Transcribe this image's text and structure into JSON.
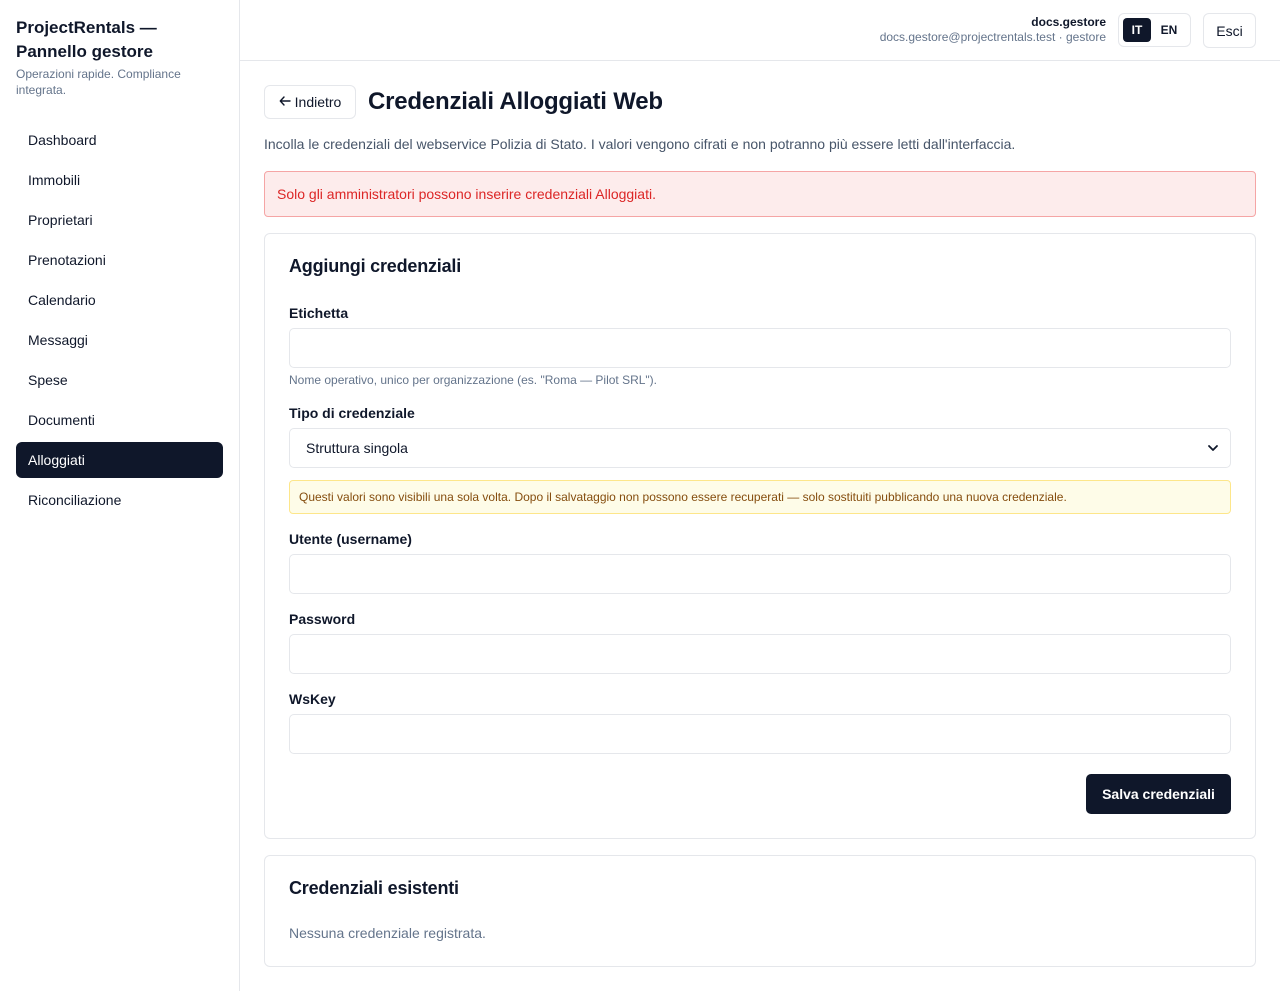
{
  "sidebar": {
    "brand_title": "ProjectRentals — Pannello gestore",
    "brand_subtitle": "Operazioni rapide. Compliance integrata.",
    "items": [
      {
        "label": "Dashboard"
      },
      {
        "label": "Immobili"
      },
      {
        "label": "Proprietari"
      },
      {
        "label": "Prenotazioni"
      },
      {
        "label": "Calendario"
      },
      {
        "label": "Messaggi"
      },
      {
        "label": "Spese"
      },
      {
        "label": "Documenti"
      },
      {
        "label": "Alloggiati",
        "active": true
      },
      {
        "label": "Riconciliazione"
      }
    ]
  },
  "topbar": {
    "user_name": "docs.gestore",
    "user_email": "docs.gestore@projectrentals.test · gestore",
    "languages": [
      {
        "label": "IT",
        "active": true
      },
      {
        "label": "EN"
      }
    ],
    "logout_label": "Esci"
  },
  "page": {
    "back_label": "Indietro",
    "back_icon": "arrow-left-icon",
    "title": "Credenziali Alloggiati Web",
    "intro": "Incolla le credenziali del webservice Polizia di Stato. I valori vengono cifrati e non potranno più essere letti dall'interfaccia.",
    "error_alert": "Solo gli amministratori possono inserire credenziali Alloggiati."
  },
  "form": {
    "title": "Aggiungi credenziali",
    "label_field": {
      "label": "Etichetta",
      "value": "",
      "hint": "Nome operativo, unico per organizzazione (es. \"Roma — Pilot SRL\")."
    },
    "type_field": {
      "label": "Tipo di credenziale",
      "selected": "Struttura singola"
    },
    "warning": "Questi valori sono visibili una sola volta. Dopo il salvataggio non possono essere recuperati — solo sostituiti pubblicando una nuova credenziale.",
    "username_field": {
      "label": "Utente (username)",
      "value": ""
    },
    "password_field": {
      "label": "Password",
      "value": ""
    },
    "wskey_field": {
      "label": "WsKey",
      "value": ""
    },
    "save_label": "Salva credenziali"
  },
  "existing": {
    "title": "Credenziali esistenti",
    "empty_text": "Nessuna credenziale registrata."
  },
  "colors": {
    "primary": "#0f172a",
    "error_bg": "#fdecec",
    "error_text": "#dc2626",
    "warning_bg": "#fefce8",
    "warning_text": "#854d0e"
  }
}
